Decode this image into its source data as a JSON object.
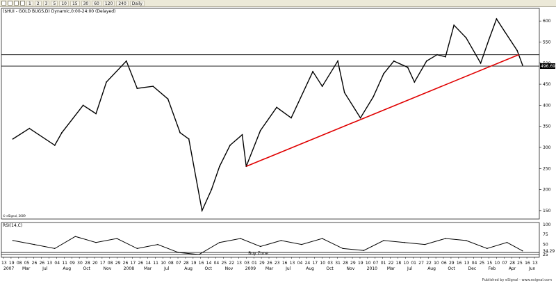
{
  "toolbar": {
    "buttons": [
      "1",
      "2",
      "3",
      "5",
      "10",
      "15",
      "30",
      "60",
      "120",
      "240",
      "Daily"
    ]
  },
  "chart_data": [
    {
      "type": "line",
      "title": "($HUI - GOLD BUGS,D) Dynamic,0:00-24:00 (Delayed)",
      "ylim": [
        130,
        630
      ],
      "yticks": [
        150,
        200,
        250,
        300,
        350,
        400,
        450,
        500,
        550,
        600
      ],
      "last_value_label": "496.696",
      "copyright": "© eSignal, 2009",
      "series": [
        {
          "x": [
            "2007-04-13",
            "2007-06-01",
            "2007-08-15",
            "2007-09-05",
            "2007-11-07",
            "2007-12-15",
            "2008-01-15",
            "2008-03-14",
            "2008-04-15",
            "2008-06-01",
            "2008-07-15",
            "2008-08-20",
            "2008-09-15",
            "2008-10-24",
            "2008-11-21",
            "2008-12-15",
            "2009-01-15",
            "2009-02-20",
            "2009-03-04",
            "2009-04-15",
            "2009-06-02",
            "2009-07-15",
            "2009-09-17",
            "2009-10-15",
            "2009-11-30",
            "2009-12-20",
            "2010-02-05",
            "2010-03-15",
            "2010-04-15",
            "2010-05-15",
            "2010-06-25",
            "2010-07-15",
            "2010-08-20",
            "2010-09-20",
            "2010-10-15",
            "2010-11-09",
            "2010-12-15",
            "2011-01-27",
            "2011-02-20",
            "2011-03-15",
            "2011-04-08",
            "2011-05-15",
            "2011-05-31"
          ],
          "values": [
            320,
            345,
            305,
            335,
            400,
            380,
            455,
            505,
            440,
            445,
            415,
            335,
            320,
            150,
            200,
            255,
            305,
            330,
            255,
            340,
            395,
            370,
            480,
            445,
            505,
            430,
            370,
            420,
            475,
            505,
            490,
            455,
            505,
            520,
            515,
            590,
            560,
            500,
            555,
            605,
            575,
            530,
            495
          ]
        }
      ],
      "trendline": {
        "from": {
          "x": "2009-03-04",
          "y": 255
        },
        "to": {
          "x": "2011-05-20",
          "y": 520
        },
        "color": "#e00000"
      },
      "horizontal_lines": [
        520,
        493
      ],
      "xaxis": {
        "tick_labels": [
          "13",
          "19",
          "08",
          "05",
          "26",
          "26",
          "13",
          "04",
          "11",
          "09",
          "30",
          "28",
          "20",
          "17",
          "08",
          "29",
          "26",
          "17",
          "26",
          "14",
          "11",
          "10",
          "08",
          "07",
          "28",
          "19",
          "16",
          "14",
          "04",
          "25",
          "22",
          "13",
          "03",
          "01",
          "29",
          "26",
          "23",
          "16",
          "13",
          "04",
          "24",
          "17",
          "10",
          "03",
          "31",
          "28",
          "29",
          "19",
          "10",
          "07",
          "01",
          "22",
          "18",
          "10",
          "01",
          "27",
          "22",
          "10",
          "06",
          "29",
          "16",
          "13",
          "04",
          "25",
          "15",
          "10",
          "07",
          "28",
          "25",
          "16",
          "13"
        ],
        "month_labels": [
          "Mar",
          "Jul",
          "Aug",
          "Oct",
          "Nov",
          "2008",
          "Mar",
          "Jul",
          "Aug",
          "Oct",
          "Nov",
          "2009",
          "Mar",
          "Jul",
          "Aug",
          "Oct",
          "Nov",
          "2010",
          "Mar",
          "Jul",
          "Aug",
          "Oct",
          "Dec",
          "Feb",
          "Apr",
          "Jun"
        ],
        "year_label": "2007"
      },
      "grid": false
    },
    {
      "type": "line",
      "title": "RSI(14,C)",
      "ylim": [
        18,
        105
      ],
      "yticks": [
        25,
        50,
        75,
        100
      ],
      "last_value_label": "34.29",
      "series": [
        {
          "x": [
            "2007-04-13",
            "2007-06-15",
            "2007-08-15",
            "2007-10-15",
            "2007-12-15",
            "2008-02-15",
            "2008-04-15",
            "2008-06-15",
            "2008-08-15",
            "2008-10-15",
            "2008-12-15",
            "2009-02-15",
            "2009-04-15",
            "2009-06-15",
            "2009-08-15",
            "2009-10-15",
            "2009-12-15",
            "2010-02-15",
            "2010-04-15",
            "2010-06-15",
            "2010-08-15",
            "2010-10-15",
            "2010-12-15",
            "2011-02-15",
            "2011-04-15",
            "2011-05-31"
          ],
          "values": [
            60,
            50,
            40,
            70,
            55,
            65,
            40,
            50,
            30,
            25,
            55,
            65,
            45,
            60,
            50,
            65,
            40,
            35,
            60,
            55,
            50,
            65,
            60,
            40,
            55,
            34
          ]
        }
      ],
      "horizontal_lines": [
        30,
        25
      ],
      "annotations": [
        {
          "text": "Buy Zone",
          "near_value": 27
        }
      ]
    }
  ],
  "footer": {
    "published_by": "Published by eSignal - www.esignal.com"
  }
}
